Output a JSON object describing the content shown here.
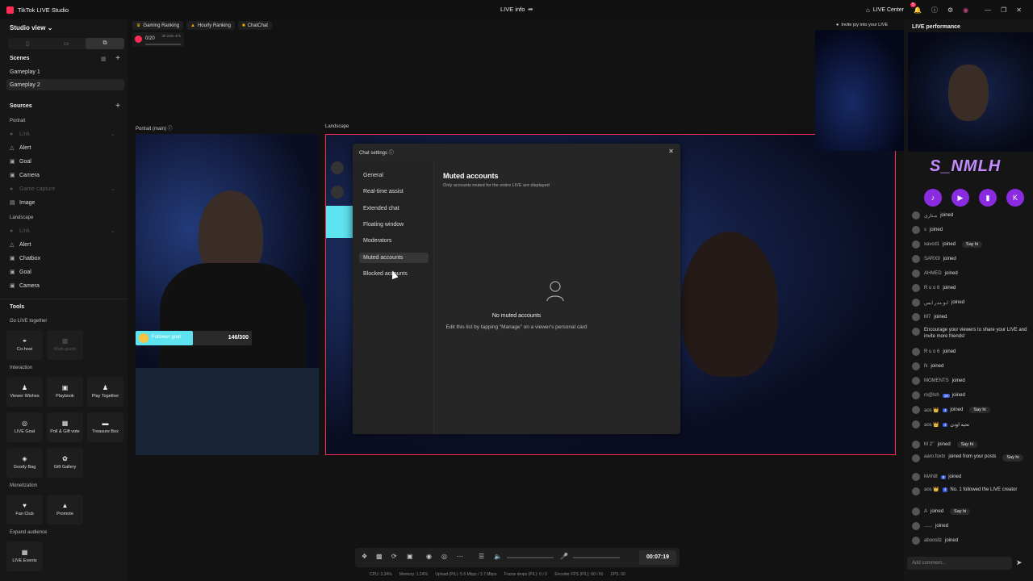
{
  "app": {
    "title": "TikTok LIVE Studio",
    "center_title": "LIVE info",
    "live_center": "LIVE Center",
    "notif_count": "5"
  },
  "left": {
    "studio_view": "Studio view",
    "scenes_h": "Scenes",
    "scenes": [
      "Gameplay 1",
      "Gameplay 2"
    ],
    "sources_h": "Sources",
    "portrait_h": "Portrait",
    "portrait_src": [
      {
        "label": "Link",
        "dim": true
      },
      {
        "label": "Alert"
      },
      {
        "label": "Goal"
      },
      {
        "label": "Camera"
      },
      {
        "label": "Game capture",
        "dim": true
      },
      {
        "label": "Image"
      }
    ],
    "landscape_h": "Landscape",
    "landscape_src": [
      {
        "label": "Link",
        "dim": true
      },
      {
        "label": "Alert"
      },
      {
        "label": "Chatbox"
      },
      {
        "label": "Goal"
      },
      {
        "label": "Camera"
      }
    ],
    "tools_h": "Tools",
    "go_live_h": "Go LIVE together",
    "co_host": "Co-host",
    "multi_guest": "Multi-guest",
    "interaction_h": "Interaction",
    "viewer_wishes": "Viewer Wishes",
    "playbook": "Playbook",
    "play_together": "Play Together",
    "live_goal": "LIVE Goal",
    "poll_vote": "Poll & Gift vote",
    "treasure_box": "Treasure Box",
    "goody_bag": "Goody Bag",
    "gift_gallery": "Gift Gallery",
    "monetization_h": "Monetization",
    "fan_club": "Fan Club",
    "promote": "Promote",
    "expand_h": "Expand audience",
    "live_events": "LIVE Events"
  },
  "stage": {
    "rankings": [
      "Gaming Ranking",
      "Hourly Ranking",
      "ChatChat"
    ],
    "counter_value": "0/20",
    "counter_time": "3h 23m 47s",
    "portrait_label": "Portrait (main)",
    "landscape_label": "Landscape",
    "goal_value": "146/300",
    "goal_progress": 0.49,
    "goal_text": "Follower goal"
  },
  "modal": {
    "title": "Chat settings",
    "nav": [
      "General",
      "Real-time assist",
      "Extended chat",
      "Floating window",
      "Moderators",
      "Muted accounts",
      "Blocked accounts"
    ],
    "active": "Muted accounts",
    "heading": "Muted accounts",
    "subheading": "Only accounts muted for the entire LIVE are displayed",
    "empty_title": "No muted accounts",
    "empty_sub": "Edit this list by tapping “Manage” on a viewer's personal card"
  },
  "controls": {
    "timer": "00:07:19"
  },
  "stats": {
    "cpu": "CPU: 3.34%",
    "memory": "Memory: 1.24%",
    "upload": "Upload (P/L): 5.6 Mbps / 3.7 Mbps",
    "frame_drops": "Frame drops (P/L): 0 / 0",
    "encoder": "Encoder FPS (P/L): 60 / 60",
    "fps": "FPS: 60"
  },
  "right": {
    "header": "LIVE performance",
    "invite": "Invite joy into your LIVE",
    "brand": "S_NMLH",
    "comment_placeholder": "Add comment...",
    "say_hi": "Say hi"
  },
  "chat": [
    {
      "user": "مـتاري",
      "text": "joined",
      "sayhi": false
    },
    {
      "user": "s",
      "text": "joined",
      "sayhi": false
    },
    {
      "user": "xavcd1",
      "text": "joined",
      "sayhi": true
    },
    {
      "user": "SARX9",
      "text": "joined",
      "sayhi": false
    },
    {
      "user": "AHMED",
      "text": "joined",
      "sayhi": false
    },
    {
      "user": "R u o 6",
      "text": "joined",
      "sayhi": false
    },
    {
      "user": "ابو مدر ايس",
      "text": "joined",
      "sayhi": false
    },
    {
      "user": "M7",
      "text": "joined",
      "sayhi": false
    },
    {
      "user": "",
      "text": "Encourage your viewers to share your LIVE and invite more friends!",
      "sayhi": false
    },
    {
      "user": "R u o 6",
      "text": "joined",
      "sayhi": false
    },
    {
      "user": "N",
      "text": "joined",
      "sayhi": false
    },
    {
      "user": "MOMENTS",
      "text": "joined",
      "sayhi": false
    },
    {
      "user": "m@lsh",
      "level": "18",
      "text": "joined",
      "sayhi": false
    },
    {
      "user": "aos 👑",
      "level": "4",
      "text": "joined",
      "sayhi": true
    },
    {
      "user": "aos 👑",
      "level": "4",
      "text": "تحيه اودن",
      "sayhi": false
    },
    {
      "user": "M 2ʼʼ",
      "text": "joined",
      "sayhi": true
    },
    {
      "user": "aaro.foxtx",
      "text": "joined from your posts",
      "sayhi": true
    },
    {
      "user": "MAN8",
      "level": "9",
      "text": "joined",
      "sayhi": false
    },
    {
      "user": "aos 👑",
      "level": "4",
      "text": "No. 1 followed the LIVE creator",
      "sayhi": false
    },
    {
      "user": "A",
      "text": "joined",
      "sayhi": true
    },
    {
      "user": "......",
      "text": "joined",
      "sayhi": false
    },
    {
      "user": "aboosllz",
      "text": "joined",
      "sayhi": false
    }
  ]
}
